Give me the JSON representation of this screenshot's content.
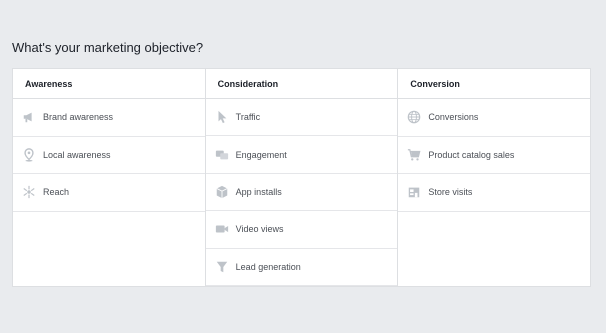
{
  "page": {
    "title": "What's your marketing objective?"
  },
  "columns": [
    {
      "header": "Awareness",
      "items": [
        {
          "label": "Brand awareness",
          "icon": "megaphone-icon"
        },
        {
          "label": "Local awareness",
          "icon": "map-pin-icon"
        },
        {
          "label": "Reach",
          "icon": "reach-icon"
        }
      ]
    },
    {
      "header": "Consideration",
      "items": [
        {
          "label": "Traffic",
          "icon": "cursor-icon"
        },
        {
          "label": "Engagement",
          "icon": "chat-bubbles-icon"
        },
        {
          "label": "App installs",
          "icon": "box-icon"
        },
        {
          "label": "Video views",
          "icon": "video-camera-icon"
        },
        {
          "label": "Lead generation",
          "icon": "funnel-icon"
        }
      ]
    },
    {
      "header": "Conversion",
      "items": [
        {
          "label": "Conversions",
          "icon": "globe-icon"
        },
        {
          "label": "Product catalog sales",
          "icon": "shopping-cart-icon"
        },
        {
          "label": "Store visits",
          "icon": "storefront-icon"
        }
      ]
    }
  ],
  "colors": {
    "background": "#e9ebee",
    "card": "#ffffff",
    "border": "#dddfe2",
    "icon": "#bec3c9",
    "text": "#1d2129",
    "label": "#4b4f56"
  }
}
